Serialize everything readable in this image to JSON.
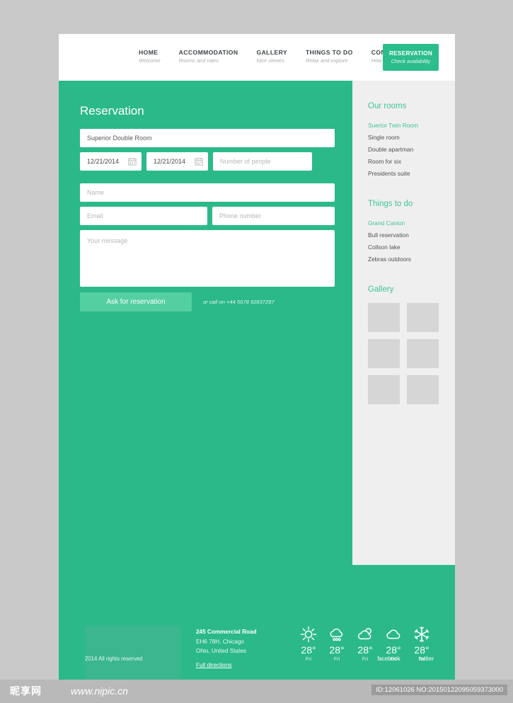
{
  "nav": {
    "items": [
      {
        "label": "HOME",
        "sub": "Welcome"
      },
      {
        "label": "ACCOMMODATION",
        "sub": "Rooms and rates"
      },
      {
        "label": "GALLERY",
        "sub": "Nice viewes"
      },
      {
        "label": "THINGS TO DO",
        "sub": "Relax and explore"
      },
      {
        "label": "CONTACT",
        "sub": "How to reach us"
      }
    ],
    "cta": {
      "label": "RESERVATION",
      "sub": "Check availability"
    }
  },
  "main": {
    "title": "Reservation",
    "form": {
      "room_value": "Superior Double Room",
      "date_from": "12/21/2014",
      "date_to": "12/21/2014",
      "people_placeholder": "Number of people",
      "name_placeholder": "Name",
      "email_placeholder": "Email",
      "phone_placeholder": "Phone number",
      "message_placeholder": "Your message",
      "submit_label": "Ask for reservation",
      "call_note": "or call on +44 5678 92837287"
    }
  },
  "sidebar": {
    "rooms": {
      "heading": "Our rooms",
      "items": [
        "Suerior Twin Room",
        "Single room",
        "Double apartman",
        "Room for six",
        "Presidents suite"
      ]
    },
    "things": {
      "heading": "Things to do",
      "items": [
        "Grand Canion",
        "Bull reservation",
        "Collson lake",
        "Zebras outdoors"
      ]
    },
    "gallery": {
      "heading": "Gallery",
      "tile_count": 6
    }
  },
  "footer": {
    "address": {
      "line1": "245 Commercial Road",
      "line2": "EH6 78H, Chicago",
      "line3": "Ohio, United States",
      "directions_label": "Full directions"
    },
    "weather": [
      {
        "icon": "sun-icon",
        "temp": "28°",
        "day": "Fri"
      },
      {
        "icon": "rain-cloud-icon",
        "temp": "28°",
        "day": "Fri"
      },
      {
        "icon": "partly-cloudy-icon",
        "temp": "28°",
        "day": "Fri"
      },
      {
        "icon": "cloud-icon",
        "temp": "28°",
        "day": "Fri"
      },
      {
        "icon": "snowflake-icon",
        "temp": "28°",
        "day": "Fri"
      }
    ],
    "copyright": "2014 All rights reserved",
    "social": [
      "facebook",
      "twitter"
    ]
  },
  "watermark": {
    "logo": "昵享网",
    "url": "www.nipic.cn",
    "id": "ID:12061026 NO:20150122095059373000"
  },
  "colors": {
    "green": "#2bb98a",
    "green_button": "#54cfa2",
    "green_accent": "#3fc495",
    "sidebar_bg": "#efefef",
    "tile": "#d6d6d6"
  }
}
